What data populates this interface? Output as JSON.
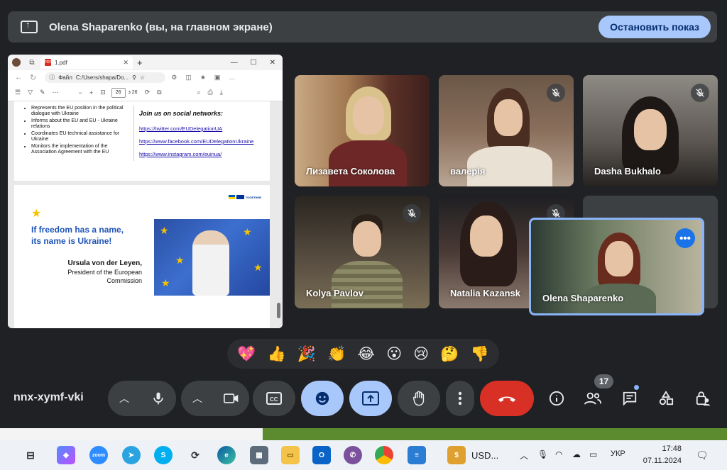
{
  "share_banner": {
    "title": "Olena Shaparenko (вы, на главном экране)",
    "stop_label": "Остановить показ"
  },
  "browser": {
    "tab_title": "1.pdf",
    "address_label": "Файл",
    "address_path": "C:/Users/shapa/Do...",
    "page_current": "26",
    "page_total": "з 26"
  },
  "pdf": {
    "page1": {
      "bullets": [
        "Represents the EU position in the political dialogue with Ukraine",
        "Informs about the EU and EU - Ukraine relations",
        "Coordinates EU technical assistance for Ukraine",
        "Monitors the implementation of the Association Agreement with the EU"
      ],
      "social_heading": "Join us on social networks:",
      "links": [
        "https://twitter.com/EUDelegationUA",
        "https://www.facebook.com/EUDelegationUkraine",
        "https://www.instagram.com/euinua/"
      ]
    },
    "page2": {
      "logo_text": "TOGETHER",
      "quote_line1": "If freedom has a name,",
      "quote_line2": "its name is Ukraine!",
      "author_name": "Ursula von der Leyen,",
      "author_title1": "President of the European",
      "author_title2": "Commission"
    }
  },
  "participants": [
    {
      "name": "Лизавета Соколова",
      "muted": false
    },
    {
      "name": "валерія",
      "muted": true
    },
    {
      "name": "Dasha Bukhalo",
      "muted": true
    },
    {
      "name": "Kolya Pavlov",
      "muted": true
    },
    {
      "name": "Natalia Kazansk",
      "muted": true
    },
    {
      "name": "Olena Shaparenko",
      "muted": false
    }
  ],
  "reactions": [
    "💖",
    "👍",
    "🎉",
    "👏",
    "😂",
    "😮",
    "😢",
    "🤔",
    "👎"
  ],
  "meeting_code": "nnx-xymf-vki",
  "participant_count": "17",
  "taskbar": {
    "usd_label": "USD...",
    "lang": "УКР",
    "time": "17:48",
    "date": "07.11.2024",
    "zoom_label": "zoom"
  },
  "colors": {
    "background": "#202124",
    "accent": "#a8c7fa",
    "leave": "#d93025",
    "highlight_border": "#8ab4f8"
  }
}
